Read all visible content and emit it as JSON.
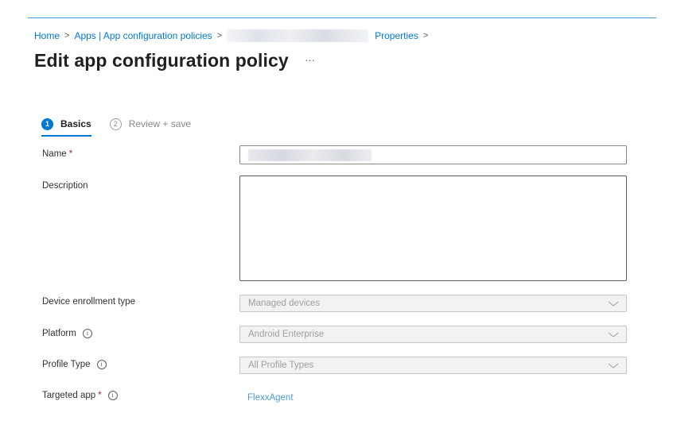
{
  "breadcrumb": {
    "home": "Home",
    "apps": "Apps | App configuration policies",
    "properties": "Properties",
    "separator": ">"
  },
  "page": {
    "title": "Edit app configuration policy",
    "more": "···"
  },
  "steps": [
    {
      "number": "1",
      "label": "Basics",
      "state": "active"
    },
    {
      "number": "2",
      "label": "Review + save",
      "state": "inactive"
    }
  ],
  "form": {
    "name": {
      "label": "Name",
      "required": "*",
      "value": ""
    },
    "description": {
      "label": "Description",
      "value": ""
    },
    "enrollment": {
      "label": "Device enrollment type",
      "value": "Managed devices"
    },
    "platform": {
      "label": "Platform",
      "value": "Android Enterprise"
    },
    "profile": {
      "label": "Profile Type",
      "value": "All Profile Types"
    },
    "targeted_app": {
      "label": "Targeted app",
      "required": "*",
      "value": "FlexxAgent"
    }
  },
  "icons": {
    "info": "info-icon",
    "chevron": "chevron-down-icon"
  },
  "colors": {
    "accent": "#0078d4",
    "required": "#a4262c",
    "disabled_bg": "#f3f2f1",
    "disabled_text": "#a19f9d"
  }
}
